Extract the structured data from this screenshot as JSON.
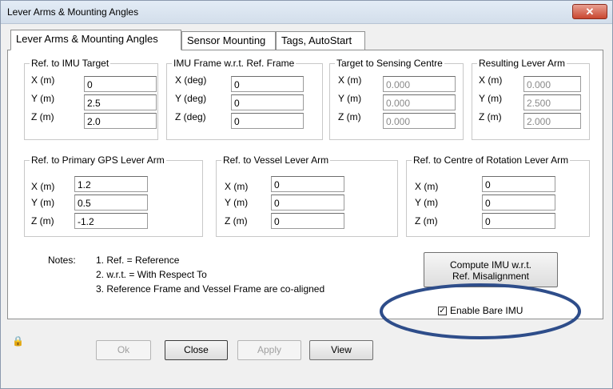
{
  "window": {
    "title": "Lever Arms & Mounting Angles",
    "close_glyph": "✕"
  },
  "tabs": [
    {
      "label": "Lever Arms & Mounting Angles"
    },
    {
      "label": "Sensor Mounting"
    },
    {
      "label": "Tags, AutoStart"
    }
  ],
  "groups": {
    "imu_target": {
      "title": "Ref. to IMU Target",
      "labels": [
        "X (m)",
        "Y (m)",
        "Z (m)"
      ],
      "values": [
        "0",
        "2.5",
        "2.0"
      ]
    },
    "imu_frame": {
      "title": "IMU Frame w.r.t. Ref. Frame",
      "labels": [
        "X (deg)",
        "Y (deg)",
        "Z (deg)"
      ],
      "values": [
        "0",
        "0",
        "0"
      ]
    },
    "target_sensing": {
      "title": "Target to Sensing Centre",
      "labels": [
        "X (m)",
        "Y (m)",
        "Z (m)"
      ],
      "values": [
        "0.000",
        "0.000",
        "0.000"
      ]
    },
    "resulting": {
      "title": "Resulting Lever Arm",
      "labels": [
        "X (m)",
        "Y (m)",
        "Z (m)"
      ],
      "values": [
        "0.000",
        "2.500",
        "2.000"
      ]
    },
    "primary_gps": {
      "title": "Ref. to Primary GPS Lever Arm",
      "labels": [
        "X (m)",
        "Y (m)",
        "Z (m)"
      ],
      "values": [
        "1.2",
        "0.5",
        "-1.2"
      ]
    },
    "vessel": {
      "title": "Ref. to Vessel Lever Arm",
      "labels": [
        "X (m)",
        "Y (m)",
        "Z (m)"
      ],
      "values": [
        "0",
        "0",
        "0"
      ]
    },
    "centre_rotation": {
      "title": "Ref. to Centre of Rotation Lever Arm",
      "labels": [
        "X (m)",
        "Y (m)",
        "Z (m)"
      ],
      "values": [
        "0",
        "0",
        "0"
      ]
    }
  },
  "notes": {
    "label": "Notes:",
    "items": [
      "1. Ref. = Reference",
      "2. w.r.t. = With Respect To",
      "3. Reference Frame and Vessel Frame are co-aligned"
    ]
  },
  "compute_button": {
    "line1": "Compute IMU w.r.t.",
    "line2": "Ref. Misalignment"
  },
  "enable_bare_imu": {
    "label": "Enable Bare IMU",
    "checked": true,
    "check_glyph": "✓"
  },
  "annotation_color": "#2e4d8a",
  "footer": {
    "lock_glyph": "🔒",
    "ok": "Ok",
    "close": "Close",
    "apply": "Apply",
    "view": "View"
  }
}
